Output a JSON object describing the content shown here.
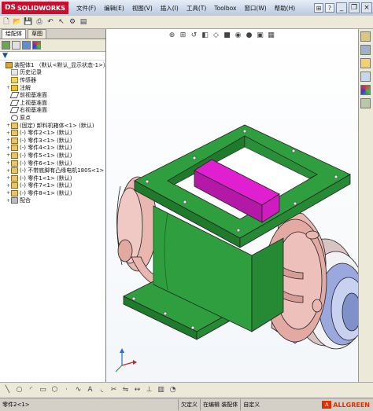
{
  "app": {
    "logo_prefix": "DS",
    "logo_text": "SOLIDWORKS"
  },
  "menu": [
    "文件(F)",
    "编辑(E)",
    "视图(V)",
    "插入(I)",
    "工具(T)",
    "Toolbox",
    "窗口(W)",
    "帮助(H)"
  ],
  "window_controls": {
    "pin": "⊞",
    "help": "?",
    "minimize": "_",
    "restore": "❐",
    "close": "×"
  },
  "panel": {
    "tabs": [
      "绘配体",
      "草图"
    ],
    "active_tab": 0
  },
  "tree": {
    "root": "装配体1 （默认<默认_显示状态-1>）",
    "items": [
      {
        "label": "历史记录",
        "icon": "history-icon",
        "expander": ""
      },
      {
        "label": "传感器",
        "icon": "sensor-icon",
        "expander": ""
      },
      {
        "label": "注解",
        "icon": "annotation-icon",
        "expander": "+"
      },
      {
        "label": "前视基准面",
        "icon": "plane-icon",
        "expander": ""
      },
      {
        "label": "上视基准面",
        "icon": "plane-icon",
        "expander": ""
      },
      {
        "label": "右视基准面",
        "icon": "plane-icon",
        "expander": ""
      },
      {
        "label": "原点",
        "icon": "origin-icon",
        "expander": ""
      },
      {
        "label": "(固定) 卸料机箱体<1> (默认)",
        "icon": "part-icon",
        "expander": "+"
      },
      {
        "label": "(-) 零件2<1> (默认)",
        "icon": "part-icon",
        "expander": "+"
      },
      {
        "label": "(-) 零件3<1> (默认)",
        "icon": "part-icon",
        "expander": "+"
      },
      {
        "label": "(-) 零件4<1> (默认)",
        "icon": "part-icon",
        "expander": "+"
      },
      {
        "label": "(-) 零件5<1> (默认)",
        "icon": "part-icon",
        "expander": "+"
      },
      {
        "label": "(-) 零件6<1> (默认)",
        "icon": "part-icon",
        "expander": "+"
      },
      {
        "label": "(-) 不带底脚有凸缘电机180S<1>",
        "icon": "part-icon",
        "expander": "+"
      },
      {
        "label": "(-) 零件1<1> (默认)",
        "icon": "part-icon",
        "expander": "+"
      },
      {
        "label": "(-) 零件7<1> (默认)",
        "icon": "part-icon",
        "expander": "+"
      },
      {
        "label": "(-) 零件8<1> (默认)",
        "icon": "part-icon",
        "expander": "+"
      },
      {
        "label": "配合",
        "icon": "mate-icon",
        "expander": "+"
      }
    ]
  },
  "status": {
    "left": "零件2<1>",
    "under_defined": "欠定义",
    "editing": "在编辑 装配体",
    "custom": "自定义"
  },
  "watermark": {
    "text": "ALLGREEN"
  },
  "colors": {
    "housing_green": "#2f9e3f",
    "housing_green_dark": "#1f7a2c",
    "rotor_magenta": "#e020d0",
    "flange_pink": "#e9b6b0",
    "motor_blue": "#8f9fd8"
  }
}
